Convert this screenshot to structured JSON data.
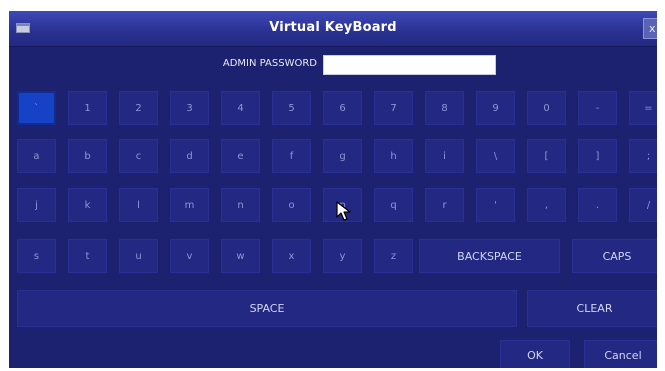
{
  "window": {
    "title": "Virtual KeyBoard",
    "close_label": "x"
  },
  "password": {
    "label": "ADMIN PASSWORD",
    "value": ""
  },
  "keyboard": {
    "row1": [
      "`",
      "1",
      "2",
      "3",
      "4",
      "5",
      "6",
      "7",
      "8",
      "9",
      "0",
      "-",
      "="
    ],
    "row2": [
      "a",
      "b",
      "c",
      "d",
      "e",
      "f",
      "g",
      "h",
      "i",
      "\\",
      "[",
      "]",
      ";"
    ],
    "row3": [
      "j",
      "k",
      "l",
      "m",
      "n",
      "o",
      "p",
      "q",
      "r",
      "'",
      ",",
      ".",
      "/"
    ],
    "row4": [
      "s",
      "t",
      "u",
      "v",
      "w",
      "x",
      "y",
      "z"
    ],
    "backspace": "BACKSPACE",
    "caps": "CAPS",
    "space": "SPACE",
    "clear": "CLEAR",
    "ok": "OK",
    "cancel": "Cancel",
    "active_key": "`"
  }
}
